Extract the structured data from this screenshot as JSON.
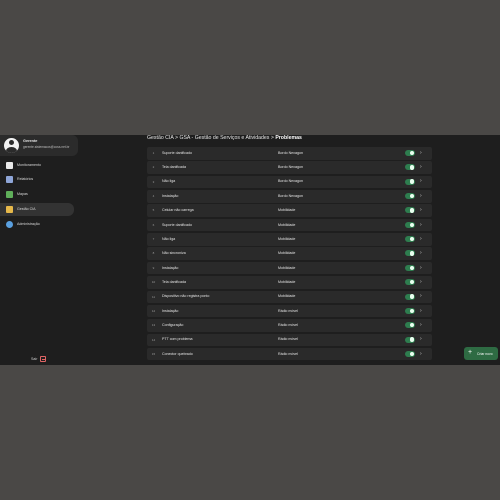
{
  "user": {
    "name": "Gerente",
    "email": "gerente.sistemacos@coss.net.br"
  },
  "sidebar": {
    "items": [
      {
        "label": "Monitoramento",
        "icon": "monitor-icon",
        "color": "#e9e9e9"
      },
      {
        "label": "Relatórios",
        "icon": "report-icon",
        "color": "#8fa6d8"
      },
      {
        "label": "Mapas",
        "icon": "map-icon",
        "color": "#5fae5a"
      },
      {
        "label": "Gestão CIA",
        "icon": "folder-icon",
        "color": "#e6b84a"
      },
      {
        "label": "Administração",
        "icon": "gear-icon",
        "color": "#5aa0e0"
      }
    ],
    "logout_label": "Sair"
  },
  "breadcrumb": {
    "path": "Gestão CIA > GSA - Gestão de Serviços e Atividades > ",
    "current": "Problemas"
  },
  "problems": [
    {
      "idx": "1",
      "name": "Suporte danificado",
      "category": "Bordo Nexagon",
      "enabled": true
    },
    {
      "idx": "2",
      "name": "Tela danificada",
      "category": "Bordo Nexagon",
      "enabled": true
    },
    {
      "idx": "3",
      "name": "Não liga",
      "category": "Bordo Nexagon",
      "enabled": true
    },
    {
      "idx": "4",
      "name": "Instalação",
      "category": "Bordo Nexagon",
      "enabled": true
    },
    {
      "idx": "5",
      "name": "Celular não carrega",
      "category": "Mobilidade",
      "enabled": true
    },
    {
      "idx": "6",
      "name": "Suporte danificado",
      "category": "Mobilidade",
      "enabled": true
    },
    {
      "idx": "7",
      "name": "Não liga",
      "category": "Mobilidade",
      "enabled": true
    },
    {
      "idx": "8",
      "name": "Não sincroniza",
      "category": "Mobilidade",
      "enabled": true
    },
    {
      "idx": "9",
      "name": "Instalação",
      "category": "Mobilidade",
      "enabled": true
    },
    {
      "idx": "10",
      "name": "Tela danificada",
      "category": "Mobilidade",
      "enabled": true
    },
    {
      "idx": "11",
      "name": "Dispositivo não registra ponto",
      "category": "Mobilidade",
      "enabled": true
    },
    {
      "idx": "12",
      "name": "Instalação",
      "category": "Rádio móvel",
      "enabled": true
    },
    {
      "idx": "13",
      "name": "Configuração",
      "category": "Rádio móvel",
      "enabled": true
    },
    {
      "idx": "14",
      "name": "PTT com problema",
      "category": "Rádio móvel",
      "enabled": true
    },
    {
      "idx": "15",
      "name": "Conector quebrado",
      "category": "Rádio móvel",
      "enabled": true
    }
  ],
  "fab": {
    "label": "Criar novo"
  },
  "colors": {
    "accent": "#2e7d4f",
    "toggle_on": "#2e7d4f",
    "logout": "#e06565"
  }
}
